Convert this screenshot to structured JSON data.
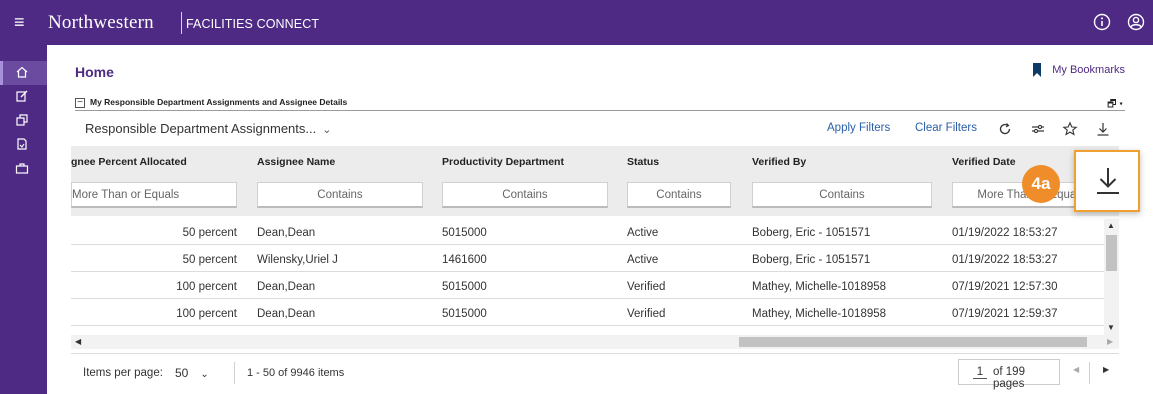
{
  "app": {
    "logo": "Northwestern",
    "subtitle": "FACILITIES CONNECT"
  },
  "header_icons": [
    "hamburger-icon",
    "info-icon",
    "user-icon"
  ],
  "sidebar": {
    "items": [
      "home-icon",
      "edit-icon",
      "copy-icon",
      "document-icon",
      "briefcase-icon"
    ]
  },
  "page": {
    "title": "Home",
    "bookmarks_label": "My Bookmarks"
  },
  "section": {
    "toggle": "−",
    "title": "My Responsible Department Assignments and Assignee Details",
    "tools": "🗗 ▾"
  },
  "toolbar": {
    "view_name": "Responsible Department Assignments...",
    "view_chevron": "⌄",
    "apply_filters": "Apply Filters",
    "clear_filters": "Clear Filters"
  },
  "grid": {
    "columns": [
      "gnee Percent Allocated",
      "Assignee Name",
      "Productivity Department",
      "Status",
      "Verified By",
      "Verified Date"
    ],
    "filters": [
      "More Than or Equals",
      "Contains",
      "Contains",
      "Contains",
      "Contains",
      "More Than or Equals"
    ],
    "rows": [
      [
        "50 percent",
        "Dean,Dean",
        "5015000",
        "Active",
        "Boberg, Eric - 1051571",
        "01/19/2022 18:53:27"
      ],
      [
        "50 percent",
        "Wilensky,Uriel J",
        "1461600",
        "Active",
        "Boberg, Eric - 1051571",
        "01/19/2022 18:53:27"
      ],
      [
        "100 percent",
        "Dean,Dean",
        "5015000",
        "Verified",
        "Mathey, Michelle-1018958",
        "07/19/2021 12:57:30"
      ],
      [
        "100 percent",
        "Dean,Dean",
        "5015000",
        "Verified",
        "Mathey, Michelle-1018958",
        "07/19/2021 12:59:37"
      ]
    ]
  },
  "pager": {
    "items_per_page_label": "Items per page:",
    "page_size": "50",
    "page_size_chevron": "⌄",
    "count_text": "1 - 50 of 9946 items",
    "current_page": "1",
    "of_pages": "of 199 pages"
  },
  "callout": {
    "badge": "4a",
    "icon": "download-icon"
  },
  "colors": {
    "brand": "#4e2a84",
    "link": "#2a5ea8",
    "callout": "#ef8d2b"
  }
}
